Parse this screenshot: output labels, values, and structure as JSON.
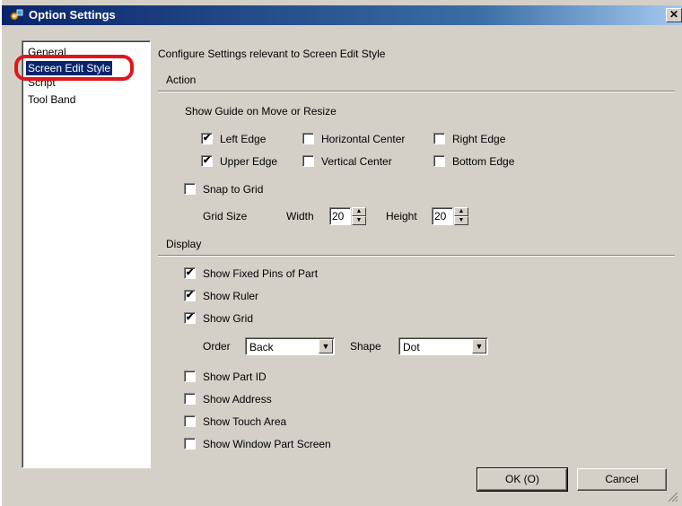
{
  "window": {
    "title": "Option Settings",
    "close_glyph": "✕"
  },
  "nav": {
    "items": [
      {
        "label": "General"
      },
      {
        "label": "Screen Edit Style",
        "selected": true
      },
      {
        "label": "Script"
      },
      {
        "label": "Tool Band"
      }
    ]
  },
  "description": "Configure Settings relevant to Screen Edit Style",
  "action": {
    "heading": "Action",
    "guide_label": "Show Guide on Move or Resize",
    "guides": [
      {
        "label": "Left Edge",
        "checked": true
      },
      {
        "label": "Horizontal Center",
        "checked": false
      },
      {
        "label": "Right Edge",
        "checked": false
      },
      {
        "label": "Upper Edge",
        "checked": true
      },
      {
        "label": "Vertical Center",
        "checked": false
      },
      {
        "label": "Bottom Edge",
        "checked": false
      }
    ],
    "snap": {
      "label": "Snap to Grid",
      "checked": false
    },
    "grid_size_label": "Grid Size",
    "width_label": "Width",
    "width_value": "20",
    "height_label": "Height",
    "height_value": "20"
  },
  "display": {
    "heading": "Display",
    "fixed_pins": {
      "label": "Show Fixed Pins of Part",
      "checked": true
    },
    "ruler": {
      "label": "Show Ruler",
      "checked": true
    },
    "grid": {
      "label": "Show Grid",
      "checked": true
    },
    "order_label": "Order",
    "order_value": "Back",
    "shape_label": "Shape",
    "shape_value": "Dot",
    "part_id": {
      "label": "Show Part ID",
      "checked": false
    },
    "address": {
      "label": "Show Address",
      "checked": false
    },
    "touch_area": {
      "label": "Show Touch Area",
      "checked": false
    },
    "window_part": {
      "label": "Show Window Part Screen",
      "checked": false
    }
  },
  "buttons": {
    "ok": "OK (O)",
    "cancel": "Cancel"
  },
  "check_glyph": "✔",
  "colors": {
    "titlebar": "#0a246a",
    "selection": "#0a246a",
    "highlight_ring": "#e1161b",
    "face": "#d4d0c8"
  }
}
